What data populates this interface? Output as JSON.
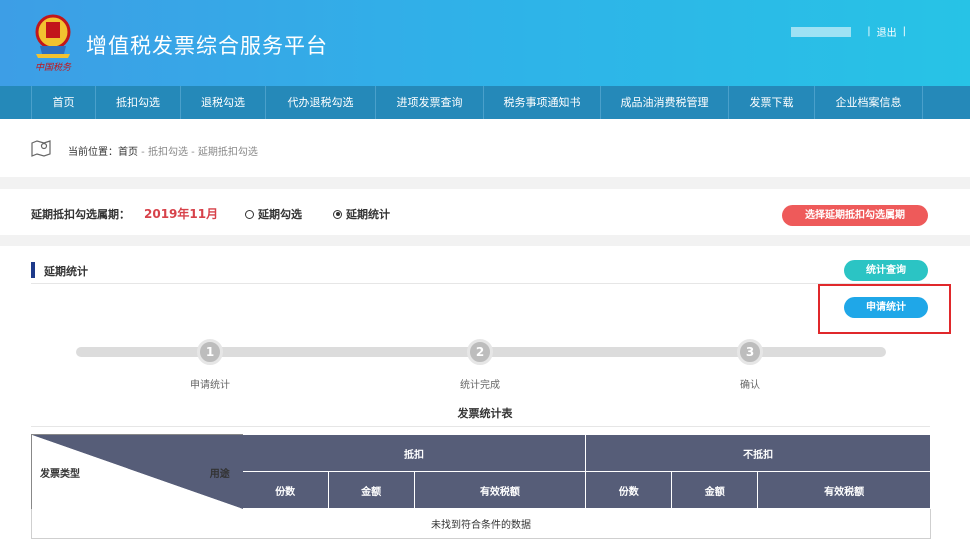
{
  "header": {
    "emblem_text": "中国税务",
    "title": "增值税发票综合服务平台",
    "separator": "|",
    "logout_label": "退出",
    "trailing_separator": "|"
  },
  "nav": {
    "items": [
      {
        "label": "首页"
      },
      {
        "label": "抵扣勾选"
      },
      {
        "label": "退税勾选"
      },
      {
        "label": "代办退税勾选"
      },
      {
        "label": "进项发票查询"
      },
      {
        "label": "税务事项通知书"
      },
      {
        "label": "成品油消费税管理"
      },
      {
        "label": "发票下载"
      },
      {
        "label": "企业档案信息"
      }
    ]
  },
  "breadcrumb": {
    "prefix": "当前位置：",
    "home": "首页",
    "path": " - 抵扣勾选 - 延期抵扣勾选"
  },
  "period": {
    "label": "延期抵扣勾选属期：",
    "value": "2019年11月",
    "radio_1": "延期勾选",
    "radio_2": "延期统计",
    "selected": "延期统计",
    "select_period_button": "选择延期抵扣勾选属期"
  },
  "section": {
    "title": "延期统计",
    "query_button": "统计查询",
    "apply_button": "申请统计"
  },
  "steps": [
    {
      "number": "1",
      "label": "申请统计"
    },
    {
      "number": "2",
      "label": "统计完成"
    },
    {
      "number": "3",
      "label": "确认"
    }
  ],
  "table": {
    "title": "发票统计表",
    "corner_left": "发票类型",
    "corner_right": "用途",
    "group_1": "抵扣",
    "group_2": "不抵扣",
    "sub_columns": [
      "份数",
      "金额",
      "有效税额",
      "份数",
      "金额",
      "有效税额"
    ],
    "empty_message": "未找到符合条件的数据"
  },
  "colors": {
    "header_gradient_start": "#3d9ee6",
    "nav_bg": "#2589b9",
    "period_value": "#d7424a",
    "red_button": "#ee5a5a",
    "teal_button": "#2bc4c4",
    "blue_button": "#1fa7e8",
    "table_header": "#565d78",
    "highlight_border": "#e0282b"
  }
}
